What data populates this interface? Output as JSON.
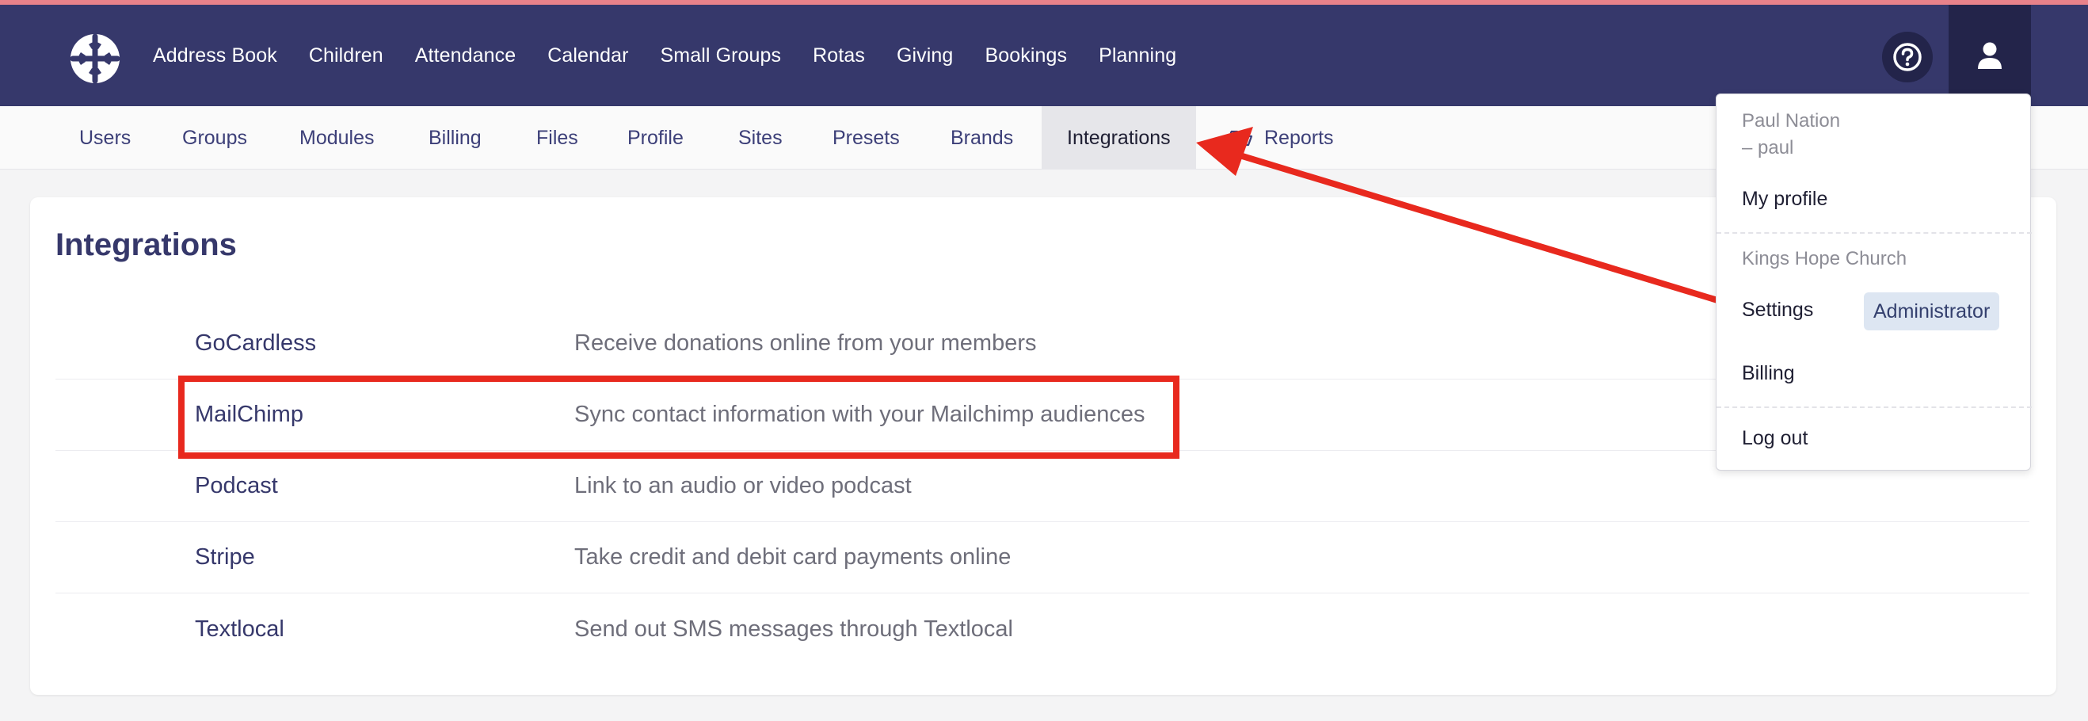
{
  "colors": {
    "nav_bg": "#36386b",
    "nav_dark": "#23244a",
    "accent_bar": "#e8828a",
    "annotation_red": "#e8291e"
  },
  "topnav": {
    "logo_icon": "church-logo-icon",
    "items": [
      "Address Book",
      "Children",
      "Attendance",
      "Calendar",
      "Small Groups",
      "Rotas",
      "Giving",
      "Bookings",
      "Planning"
    ],
    "help_icon": "question-circle-icon",
    "user_icon": "user-icon"
  },
  "subnav": {
    "items": [
      {
        "label": "Users"
      },
      {
        "label": "Groups"
      },
      {
        "label": "Modules"
      },
      {
        "label": "Billing"
      },
      {
        "label": "Files"
      },
      {
        "label": "Profile"
      },
      {
        "label": "Sites"
      },
      {
        "label": "Presets"
      },
      {
        "label": "Brands"
      },
      {
        "label": "Integrations",
        "active": true
      },
      {
        "label": "Reports",
        "icon": "folder-open-icon"
      }
    ]
  },
  "main": {
    "title": "Integrations",
    "integrations": [
      {
        "name": "GoCardless",
        "description": "Receive donations online from your members"
      },
      {
        "name": "MailChimp",
        "description": "Sync contact information with your Mailchimp audiences"
      },
      {
        "name": "Podcast",
        "description": "Link to an audio or video podcast"
      },
      {
        "name": "Stripe",
        "description": "Take credit and debit card payments online"
      },
      {
        "name": "Textlocal",
        "description": "Send out SMS messages through Textlocal"
      }
    ]
  },
  "user_menu": {
    "user_name": "Paul Nation",
    "username": "– paul",
    "my_profile": "My profile",
    "organisation": "Kings Hope Church",
    "settings": "Settings",
    "role_badge": "Administrator",
    "billing": "Billing",
    "logout": "Log out"
  }
}
